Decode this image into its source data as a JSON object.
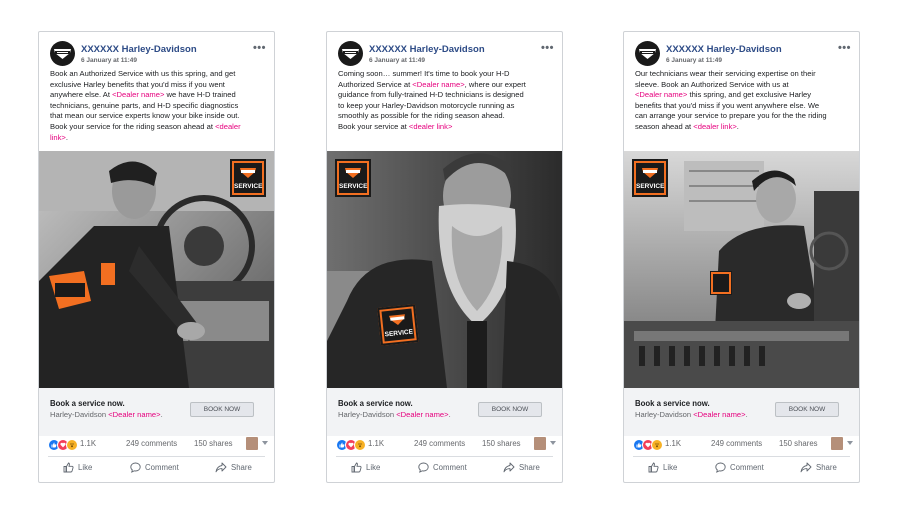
{
  "posts": [
    {
      "page_name": "XXXXXX Harley-Davidson",
      "timestamp": "6 January at 11:49",
      "text_lines": [
        "Book an Authorized Service with us this spring, and get",
        "exclusive Harley benefits that you'd miss if you went",
        [
          "anywhere else. At ",
          "<Dealer name>",
          " we have H-D trained"
        ],
        "technicians, genuine parts, and H-D specific diagnostics",
        "that mean our service experts know your bike inside out.",
        [
          "Book your service for the riding season ahead at ",
          "<dealer"
        ],
        [
          " ",
          "link>",
          "."
        ]
      ],
      "service_badge": "SERVICE",
      "cta_title": "Book a service now.",
      "cta_brand": "Harley-Davidson ",
      "cta_dealer": "<Dealer name>",
      "cta_period": ".",
      "button_label": "BOOK NOW",
      "reaction_count": "1.1K",
      "comments": "249 comments",
      "shares": "150 shares",
      "like_label": "Like",
      "comment_label": "Comment",
      "share_label": "Share"
    },
    {
      "page_name": "XXXXXX Harley-Davidson",
      "timestamp": "6 January at 11:49",
      "text_lines": [
        "Coming soon… summer! It's time to book your H-D",
        [
          "Authorized Service at ",
          "<Dealer name>",
          ", where our expert"
        ],
        "guidance from fully-trained H-D technicians is designed",
        "to keep your Harley-Davidson motorcycle running as",
        "smoothly as possible for the riding season ahead.",
        [
          "Book your service at ",
          "<dealer link>",
          ""
        ]
      ],
      "service_badge": "SERVICE",
      "cta_title": "Book a service now.",
      "cta_brand": "Harley-Davidson ",
      "cta_dealer": "<Dealer name>",
      "cta_period": ".",
      "button_label": "BOOK NOW",
      "reaction_count": "1.1K",
      "comments": "249 comments",
      "shares": "150 shares",
      "like_label": "Like",
      "comment_label": "Comment",
      "share_label": "Share"
    },
    {
      "page_name": "XXXXXX Harley-Davidson",
      "timestamp": "6 January at 11:49",
      "text_lines": [
        "Our technicians wear their servicing expertise on their",
        "sleeve. Book an Authorized Service with us at",
        [
          "",
          "<Dealer name>",
          " this spring, and get exclusive Harley"
        ],
        "benefits that you'd miss if you went anywhere else. We",
        "can arrange your service to prepare you for the the riding",
        [
          "season ahead at ",
          "<dealer link>",
          "."
        ]
      ],
      "service_badge": "SERVICE",
      "cta_title": "Book a service now.",
      "cta_brand": "Harley-Davidson ",
      "cta_dealer": "<Dealer name>",
      "cta_period": ".",
      "button_label": "BOOK NOW",
      "reaction_count": "1.1K",
      "comments": "249 comments",
      "shares": "150 shares",
      "like_label": "Like",
      "comment_label": "Comment",
      "share_label": "Share"
    }
  ],
  "colors": {
    "page_name": "#2d4b86",
    "dealer_highlight": "#e6007e",
    "badge_orange": "#f26f21",
    "like_blue": "#1877f2",
    "love_red": "#f33e58",
    "wow_yellow": "#f7b125"
  },
  "icons": [
    "hd-logo-icon",
    "more-options-icon",
    "like-reaction-icon",
    "love-reaction-icon",
    "wow-reaction-icon",
    "like-icon",
    "comment-icon",
    "share-icon",
    "dropdown-icon"
  ]
}
